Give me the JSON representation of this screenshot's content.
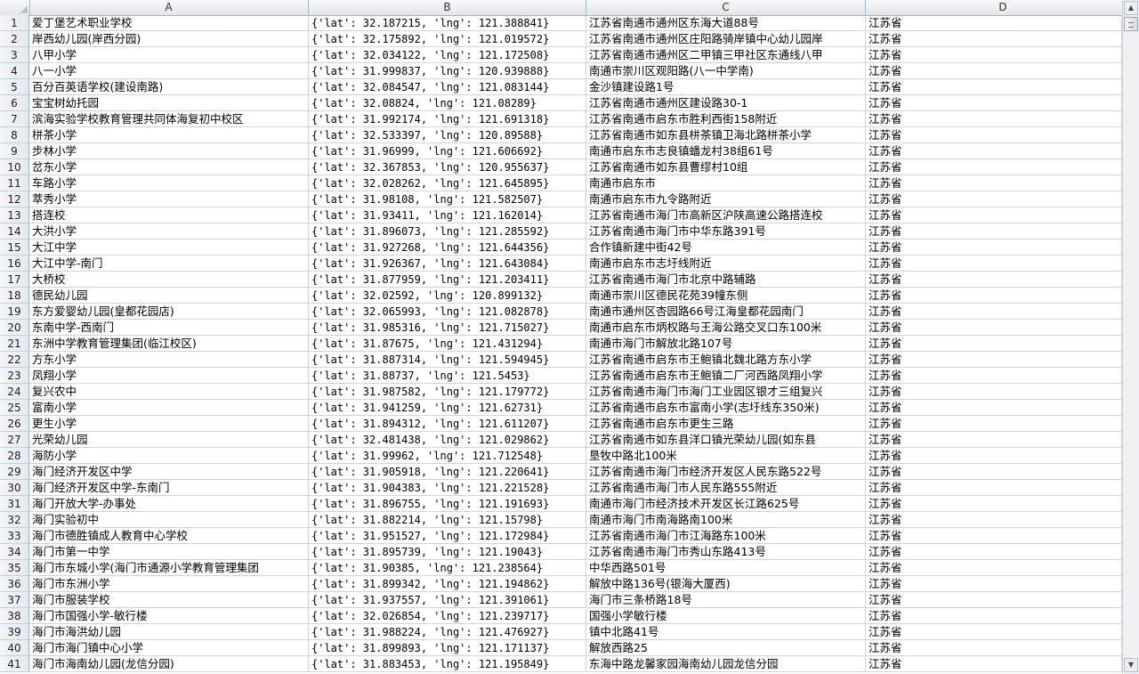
{
  "columns": [
    "A",
    "B",
    "C",
    "D"
  ],
  "rows": [
    [
      "1",
      "爱丁堡艺术职业学校",
      "{'lat': 32.187215, 'lng': 121.388841}",
      "江苏省南通市通州区东海大道88号",
      "江苏省"
    ],
    [
      "2",
      "岸西幼儿园(岸西分园)",
      "{'lat': 32.175892, 'lng': 121.019572}",
      "江苏省南通市通州区庄阳路骑岸镇中心幼儿园岸",
      "江苏省"
    ],
    [
      "3",
      "八甲小学",
      "{'lat': 32.034122, 'lng': 121.172508}",
      "江苏省南通市通州区二甲镇三甲社区东通线八甲",
      "江苏省"
    ],
    [
      "4",
      "八一小学",
      "{'lat': 31.999837, 'lng': 120.939888}",
      "南通市崇川区观阳路(八一中学南)",
      "江苏省"
    ],
    [
      "5",
      "百分百英语学校(建设南路)",
      "{'lat': 32.084547, 'lng': 121.083144}",
      "金沙镇建设路1号",
      "江苏省"
    ],
    [
      "6",
      "宝宝树幼托园",
      "{'lat': 32.08824, 'lng': 121.08289}",
      "江苏省南通市通州区建设路30-1",
      "江苏省"
    ],
    [
      "7",
      "滨海实验学校教育管理共同体海复初中校区",
      "{'lat': 31.992174, 'lng': 121.691318}",
      "江苏省南通市启东市胜利西街158附近",
      "江苏省"
    ],
    [
      "8",
      "栟茶小学",
      "{'lat': 32.533397, 'lng': 120.89588}",
      "江苏省南通市如东县栟茶镇卫海北路栟茶小学",
      "江苏省"
    ],
    [
      "9",
      "步林小学",
      "{'lat': 31.96999, 'lng': 121.606692}",
      "南通市启东市志良镇蟠龙村38组61号",
      "江苏省"
    ],
    [
      "10",
      "岔东小学",
      "{'lat': 32.367853, 'lng': 120.955637}",
      "江苏省南通市如东县曹缪村10组",
      "江苏省"
    ],
    [
      "11",
      "车路小学",
      "{'lat': 32.028262, 'lng': 121.645895}",
      "南通市启东市",
      "江苏省"
    ],
    [
      "12",
      "萃秀小学",
      "{'lat': 31.98108, 'lng': 121.582507}",
      "南通市启东市九令路附近",
      "江苏省"
    ],
    [
      "13",
      "搭连校",
      "{'lat': 31.93411, 'lng': 121.162014}",
      "江苏省南通市海门市高新区沪陕高速公路搭连校",
      "江苏省"
    ],
    [
      "14",
      "大洪小学",
      "{'lat': 31.896073, 'lng': 121.285592}",
      "江苏省南通市海门市中华东路391号",
      "江苏省"
    ],
    [
      "15",
      "大江中学",
      "{'lat': 31.927268, 'lng': 121.644356}",
      "合作镇新建中街42号",
      "江苏省"
    ],
    [
      "16",
      "大江中学-南门",
      "{'lat': 31.926367, 'lng': 121.643084}",
      "南通市启东市志圩线附近",
      "江苏省"
    ],
    [
      "17",
      "大桥校",
      "{'lat': 31.877959, 'lng': 121.203411}",
      "江苏省南通市海门市北京中路辅路",
      "江苏省"
    ],
    [
      "18",
      "德民幼儿园",
      "{'lat': 32.02592, 'lng': 120.899132}",
      "南通市崇川区德民花苑39幢东侧",
      "江苏省"
    ],
    [
      "19",
      "东方爱婴幼儿园(皇都花园店)",
      "{'lat': 32.065993, 'lng': 121.082878}",
      "南通市通州区杏园路66号江海皇都花园南门",
      "江苏省"
    ],
    [
      "20",
      "东南中学-西南门",
      "{'lat': 31.985316, 'lng': 121.715027}",
      "南通市启东市炳权路与王海公路交叉口东100米",
      "江苏省"
    ],
    [
      "21",
      "东洲中学教育管理集团(临江校区)",
      "{'lat': 31.87675, 'lng': 121.431294}",
      "南通市海门市解放北路107号",
      "江苏省"
    ],
    [
      "22",
      "方东小学",
      "{'lat': 31.887314, 'lng': 121.594945}",
      "江苏省南通市启东市王鲍镇北魏北路方东小学",
      "江苏省"
    ],
    [
      "23",
      "凤翔小学",
      "{'lat': 31.88737, 'lng': 121.5453}",
      "江苏省南通市启东市王鲍镇二厂河西路凤翔小学",
      "江苏省"
    ],
    [
      "24",
      "复兴农中",
      "{'lat': 31.987582, 'lng': 121.179772}",
      "江苏省南通市海门市海门工业园区银才三组复兴",
      "江苏省"
    ],
    [
      "25",
      "富南小学",
      "{'lat': 31.941259, 'lng': 121.62731}",
      "江苏省南通市启东市富南小学(志圩线东350米)",
      "江苏省"
    ],
    [
      "26",
      "更生小学",
      "{'lat': 31.894312, 'lng': 121.611207}",
      "江苏省南通市启东市更生三路",
      "江苏省"
    ],
    [
      "27",
      "光荣幼儿园",
      "{'lat': 32.481438, 'lng': 121.029862}",
      "江苏省南通市如东县洋口镇光荣幼儿园(如东县",
      "江苏省"
    ],
    [
      "28",
      "海防小学",
      "{'lat': 31.99962, 'lng': 121.712548}",
      "垦牧中路北100米",
      "江苏省"
    ],
    [
      "29",
      "海门经济开发区中学",
      "{'lat': 31.905918, 'lng': 121.220641}",
      "江苏省南通市海门市经济开发区人民东路522号",
      "江苏省"
    ],
    [
      "30",
      "海门经济开发区中学-东南门",
      "{'lat': 31.904383, 'lng': 121.221528}",
      "江苏省南通市海门市人民东路555附近",
      "江苏省"
    ],
    [
      "31",
      "海门开放大学-办事处",
      "{'lat': 31.896755, 'lng': 121.191693}",
      "南通市海门市经济技术开发区长江路625号",
      "江苏省"
    ],
    [
      "32",
      "海门实验初中",
      "{'lat': 31.882214, 'lng': 121.15798}",
      "南通市海门市南海路南100米",
      "江苏省"
    ],
    [
      "33",
      "海门市德胜镇成人教育中心学校",
      "{'lat': 31.951527, 'lng': 121.172984}",
      "江苏省南通市海门市江海路东100米",
      "江苏省"
    ],
    [
      "34",
      "海门市第一中学",
      "{'lat': 31.895739, 'lng': 121.19043}",
      "江苏省南通市海门市秀山东路413号",
      "江苏省"
    ],
    [
      "35",
      "海门市东城小学(海门市通源小学教育管理集团",
      "{'lat': 31.90385, 'lng': 121.238564}",
      "中华西路501号",
      "江苏省"
    ],
    [
      "36",
      "海门市东洲小学",
      "{'lat': 31.899342, 'lng': 121.194862}",
      "解放中路136号(银海大厦西)",
      "江苏省"
    ],
    [
      "37",
      "海门市服装学校",
      "{'lat': 31.937557, 'lng': 121.391061}",
      "海门市三条桥路18号",
      "江苏省"
    ],
    [
      "38",
      "海门市国强小学-敏行楼",
      "{'lat': 32.026854, 'lng': 121.239717}",
      "国强小学敏行楼",
      "江苏省"
    ],
    [
      "39",
      "海门市海洪幼儿园",
      "{'lat': 31.988224, 'lng': 121.476927}",
      "镇中北路41号",
      "江苏省"
    ],
    [
      "40",
      "海门市海门镇中心小学",
      "{'lat': 31.899893, 'lng': 121.171137}",
      "解放西路25",
      "江苏省"
    ],
    [
      "41",
      "海门市海南幼儿园(龙信分园)",
      "{'lat': 31.883453, 'lng': 121.195849}",
      "东海中路龙馨家园海南幼儿园龙信分园",
      "江苏省"
    ]
  ],
  "scrollbar": {
    "up_arrow": "▲",
    "down_arrow": "▼"
  }
}
